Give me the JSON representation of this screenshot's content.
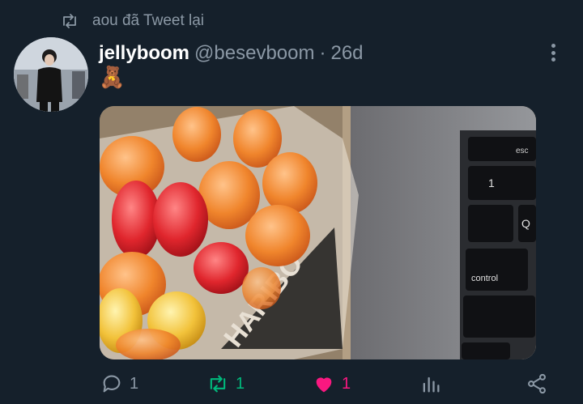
{
  "retweet_context": {
    "text": "aou đã Tweet lại",
    "icon": "retweet-icon"
  },
  "tweet": {
    "display_name": "jellyboom",
    "handle": "@besevboom",
    "separator": "·",
    "time": "26d",
    "text": "🧸",
    "media": {
      "alt": "photo of gummy bears in a Haribo tub next to a laptop keyboard",
      "key_esc": "esc",
      "key_control": "control",
      "key_1": "1",
      "key_q": "Q",
      "tub_label": "HARIBO"
    }
  },
  "actions": {
    "reply_count": "1",
    "retweet_count": "1",
    "like_count": "1"
  },
  "colors": {
    "background": "#15202b",
    "muted": "#8b98a5",
    "retweet_active": "#00ba7c",
    "like_active": "#f91880"
  }
}
